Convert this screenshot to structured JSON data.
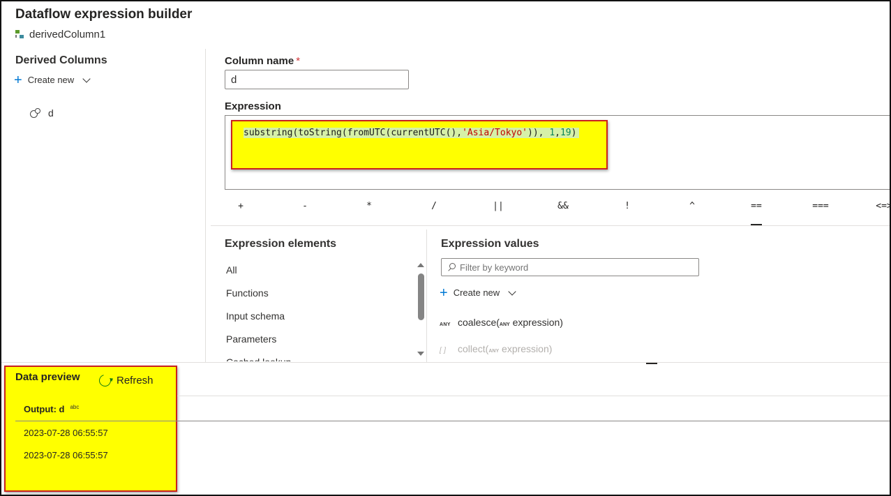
{
  "header": {
    "title": "Dataflow expression builder",
    "subtitle": "derivedColumn1"
  },
  "left_panel": {
    "heading": "Derived Columns",
    "create_new_label": "Create new",
    "columns": [
      "d"
    ]
  },
  "editor": {
    "column_name_label": "Column name",
    "required_mark": "*",
    "column_name_value": "d",
    "expression_label": "Expression",
    "expression": {
      "prefix": "substring(toString(fromUTC(currentUTC(),",
      "string_literal": "'Asia/Tokyo'",
      "middle": ")), ",
      "num1": "1",
      "comma": ",",
      "num2": "19",
      "suffix": ")"
    },
    "operators": [
      "+",
      "-",
      "*",
      "/",
      "||",
      "&&",
      "!",
      "^",
      "==",
      "===",
      "<=>"
    ]
  },
  "elements": {
    "heading": "Expression elements",
    "items": [
      "All",
      "Functions",
      "Input schema",
      "Parameters",
      "Cached lookup"
    ]
  },
  "values": {
    "heading": "Expression values",
    "filter_placeholder": "Filter by keyword",
    "create_new_label": "Create new",
    "functions": [
      {
        "badge": "ANY",
        "name": "coalesce(",
        "arg_type": "ANY",
        "arg": "expression)"
      },
      {
        "badge": "[ ]",
        "name": "collect(",
        "arg_type": "ANY",
        "arg": "expression)"
      }
    ]
  },
  "preview": {
    "title": "Data preview",
    "refresh_label": "Refresh",
    "column_header": "Output: d",
    "column_type": "abc",
    "rows": [
      "2023-07-28 06:55:57",
      "2023-07-28 06:55:57"
    ]
  }
}
